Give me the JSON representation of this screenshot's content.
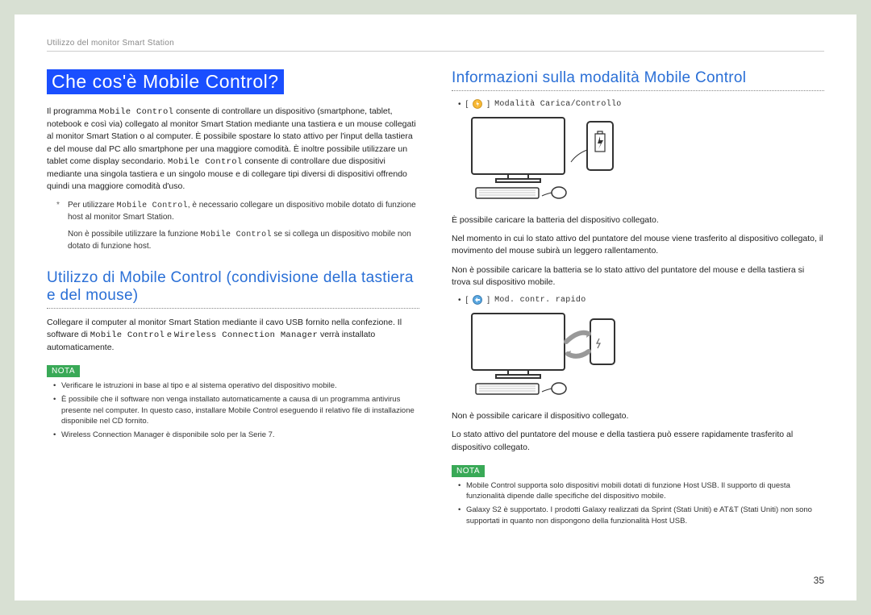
{
  "breadcrumb": "Utilizzo del monitor Smart Station",
  "left": {
    "title": "Che cos'è Mobile Control?",
    "intro_a": "Il programma ",
    "intro_mono": "Mobile Control",
    "intro_b": " consente di controllare un dispositivo (smartphone, tablet, notebook e così via) collegato al monitor Smart Station mediante una tastiera e un mouse collegati al monitor Smart Station o al computer. È possibile spostare lo stato attivo per l'input della tastiera e del mouse dal PC allo smartphone per una maggiore comodità. È inoltre possibile utilizzare un tablet come display secondario. ",
    "intro_mono2": "Mobile Control",
    "intro_c": " consente di controllare due dispositivi mediante una singola tastiera e un singolo mouse e di collegare tipi diversi di dispositivi offrendo quindi una maggiore comodità d'uso.",
    "star1_a": "Per utilizzare ",
    "star1_mono": "Mobile Control",
    "star1_b": ", è necessario collegare un dispositivo mobile dotato di funzione host al monitor Smart Station.",
    "star2_a": "Non è possibile utilizzare la funzione ",
    "star2_mono": "Mobile Control",
    "star2_b": " se si collega un dispositivo mobile non dotato di funzione host.",
    "section2": "Utilizzo di Mobile Control (condivisione della tastiera e del mouse)",
    "sec2_p_a": "Collegare il computer al monitor Smart Station mediante il cavo USB fornito nella confezione. Il software di ",
    "sec2_p_mono1": "Mobile Control",
    "sec2_p_mid": " e ",
    "sec2_p_mono2": "Wireless Connection Manager",
    "sec2_p_b": " verrà installato automaticamente.",
    "nota_label": "NOTA",
    "nota_items": [
      "Verificare le istruzioni in base al tipo e al sistema operativo del dispositivo mobile.",
      "È possibile che il software non venga installato automaticamente a causa di un programma antivirus presente nel computer. In questo caso, installare Mobile Control eseguendo il relativo file di installazione disponibile nel CD fornito.",
      "Wireless Connection Manager è disponibile solo per la Serie 7."
    ]
  },
  "right": {
    "title": "Informazioni sulla modalità Mobile Control",
    "mode1_label": "Modalità Carica/Controllo",
    "mode1_p1": "È possibile caricare la batteria del dispositivo collegato.",
    "mode1_p2": "Nel momento in cui lo stato attivo del puntatore del mouse viene trasferito al dispositivo collegato, il movimento del mouse subirà un leggero rallentamento.",
    "mode1_p3": "Non è possibile caricare la batteria se lo stato attivo del puntatore del mouse e della tastiera si trova sul dispositivo mobile.",
    "mode2_label": "Mod. contr. rapido",
    "mode2_p1": "Non è possibile caricare il dispositivo collegato.",
    "mode2_p2": "Lo stato attivo del puntatore del mouse e della tastiera può essere rapidamente trasferito al dispositivo collegato.",
    "nota_label": "NOTA",
    "nota_items": [
      "Mobile Control supporta solo dispositivi mobili dotati di funzione Host USB. Il supporto di questa funzionalità dipende dalle specifiche del dispositivo mobile.",
      "Galaxy S2 è supportato. I prodotti Galaxy realizzati da Sprint (Stati Uniti) e AT&T (Stati Uniti) non sono supportati in quanto non dispongono della funzionalità Host USB."
    ]
  },
  "page_number": "35"
}
